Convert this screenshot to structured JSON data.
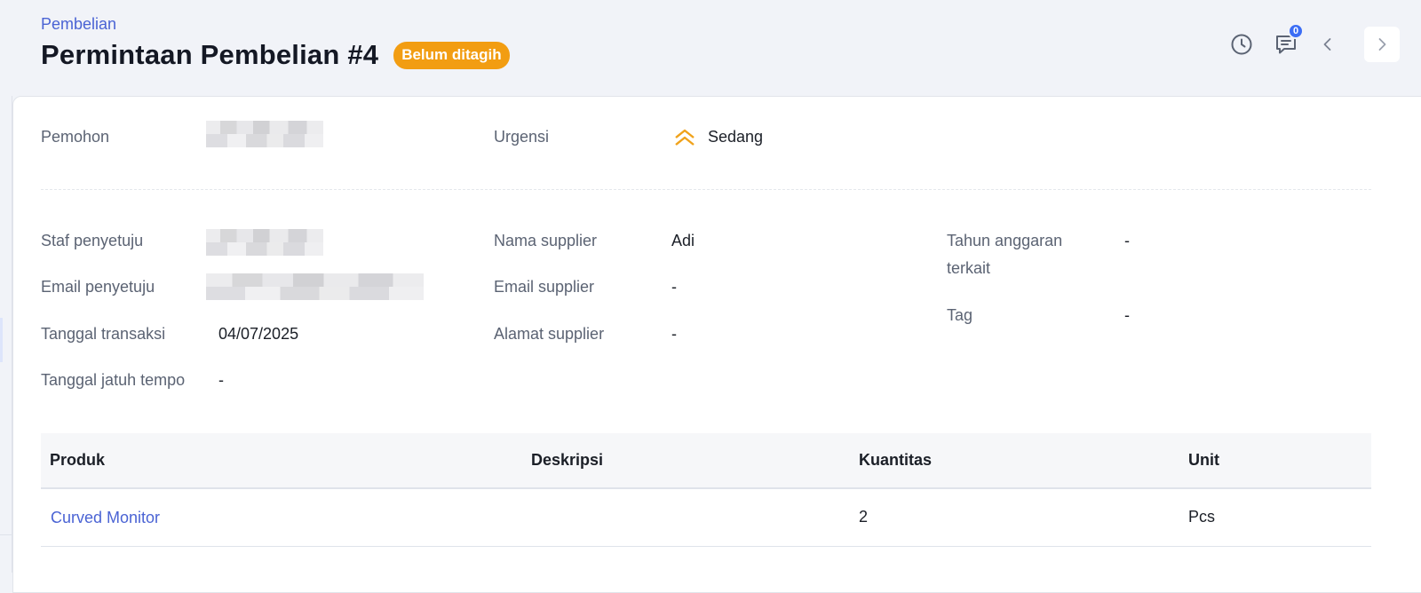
{
  "header": {
    "breadcrumb": "Pembelian",
    "title": "Permintaan Pembelian #4",
    "status": "Belum ditagih",
    "status_color": "#f29d12",
    "comment_count": "0",
    "actions": [
      "clock-icon",
      "comment-icon",
      "chevron-left-icon",
      "chevron-right-icon"
    ]
  },
  "summary": {
    "requester_label": "Pemohon",
    "urgency_label": "Urgensi",
    "urgency_value": "Sedang",
    "urgency_color": "#f0a21a"
  },
  "details": {
    "col1": {
      "approver_label": "Staf penyetuju",
      "approver_email_label": "Email penyetuju",
      "transaction_date_label": "Tanggal transaksi",
      "transaction_date_value": "04/07/2025",
      "due_date_label": "Tanggal jatuh tempo",
      "due_date_value": "-"
    },
    "col2": {
      "supplier_name_label": "Nama supplier",
      "supplier_name_value": "Adi",
      "supplier_email_label": "Email supplier",
      "supplier_email_value": "-",
      "supplier_address_label": "Alamat supplier",
      "supplier_address_value": "-"
    },
    "col3": {
      "budget_year_label_1": "Tahun anggaran",
      "budget_year_label_2": "terkait",
      "budget_year_value": "-",
      "tag_label": "Tag",
      "tag_value": "-"
    }
  },
  "table": {
    "headers": [
      "Produk",
      "Deskripsi",
      "Kuantitas",
      "Unit"
    ],
    "rows": [
      {
        "product": "Curved Monitor",
        "description": "",
        "quantity": "2",
        "unit": "Pcs"
      }
    ]
  }
}
